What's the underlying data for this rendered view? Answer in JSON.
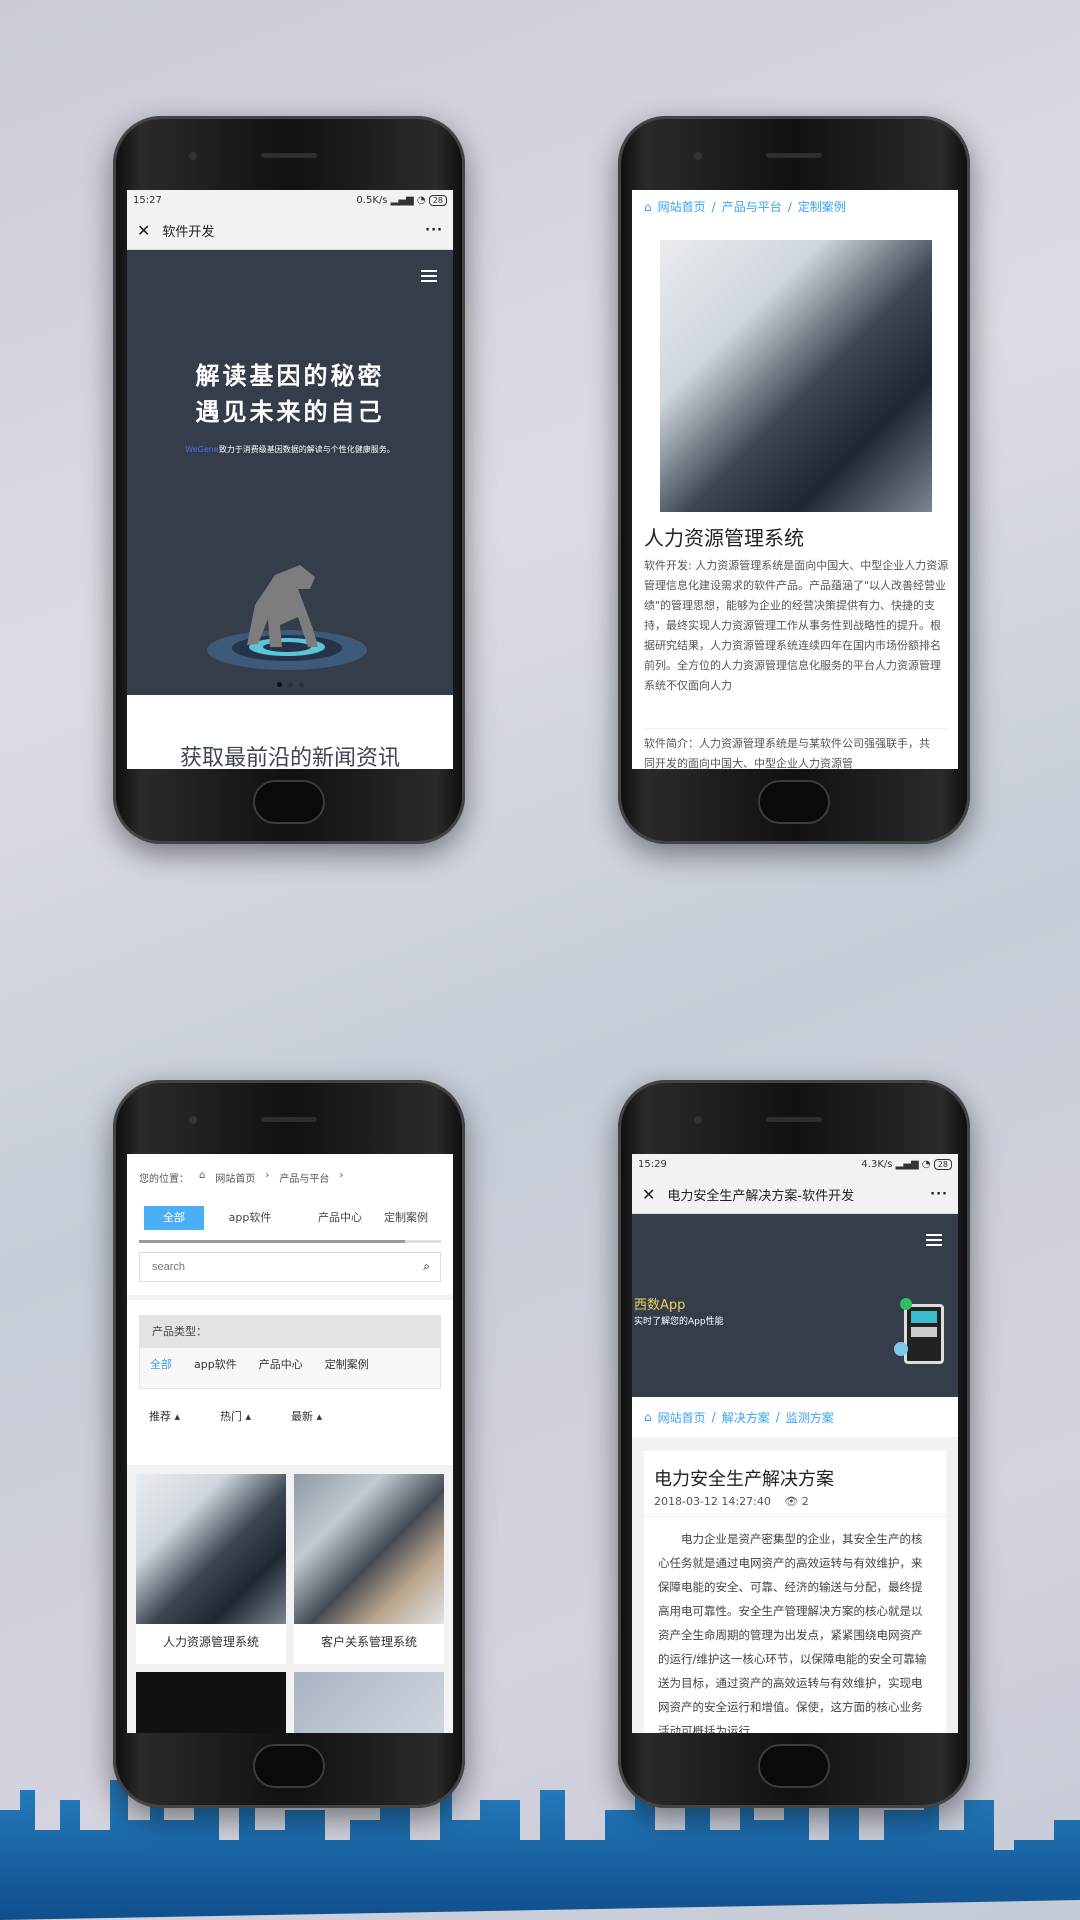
{
  "phone1": {
    "status": {
      "time": "15:27",
      "speed": "0.5K/s",
      "battery": "28"
    },
    "titlebar": {
      "title": "软件开发",
      "close_icon": "close-icon",
      "more": "···"
    },
    "hero": {
      "line1": "解读基因的秘密",
      "line2": "遇见未来的自己",
      "brand": "WeGene",
      "tagline": "致力于消费级基因数据的解读与个性化健康服务。"
    },
    "carousel": {
      "count": 3,
      "active": 1
    },
    "section_title": "获取最前沿的新闻资讯"
  },
  "phone2": {
    "breadcrumb": [
      "网站首页",
      "产品与平台",
      "定制案例"
    ],
    "title": "人力资源管理系统",
    "body": "软件开发: 人力资源管理系统是面向中国大、中型企业人力资源管理信息化建设需求的软件产品。产品蕴涵了\"以人改善经营业绩\"的管理思想，能够为企业的经营决策提供有力、快捷的支持，最终实现人力资源管理工作从事务性到战略性的提升。根据研究结果，人力资源管理系统连续四年在国内市场份额排名前列。全方位的人力资源管理信息化服务的平台人力资源管理系统不仅面向人力",
    "intro": "软件简介：人力资源管理系统是与某软件公司强强联手，共同开发的面向中国大、中型企业人力资源管"
  },
  "phone3": {
    "breadcrumb": {
      "label": "您的位置：",
      "items": [
        "网站首页",
        "产品与平台"
      ]
    },
    "tabs": [
      "全部",
      "app软件",
      "产品中心",
      "定制案例"
    ],
    "search_placeholder": "search",
    "filter": {
      "label": "产品类型：",
      "options": [
        "全部",
        "app软件",
        "产品中心",
        "定制案例"
      ]
    },
    "sort": [
      "推荐",
      "热门",
      "最新"
    ],
    "cards": [
      "人力资源管理系统",
      "客户关系管理系统"
    ]
  },
  "phone4": {
    "status": {
      "time": "15:29",
      "speed": "4.3K/s",
      "battery": "28"
    },
    "titlebar": {
      "title": "电力安全生产解决方案-软件开发",
      "more": "···"
    },
    "hero": {
      "title": "西数App",
      "subtitle": "实时了解您的App性能"
    },
    "breadcrumb": [
      "网站首页",
      "解决方案",
      "监测方案"
    ],
    "article": {
      "title": "电力安全生产解决方案",
      "date": "2018-03-12 14:27:40",
      "views": "2",
      "body": "电力企业是资产密集型的企业，其安全生产的核心任务就是通过电网资产的高效运转与有效维护，来保障电能的安全、可靠、经济的输送与分配，最终提高用电可靠性。安全生产管理解决方案的核心就是以资产全生命周期的管理为出发点，紧紧围绕电网资产的运行/维护这一核心环节，以保障电能的安全可靠输送为目标，通过资产的高效运转与有效维护，实现电网资产的安全运行和增值。保使，这方面的核心业务活动可概括为运行"
    }
  },
  "colors": {
    "accent": "#3aa2f0",
    "hero_bg": "#353d4b",
    "skyline": "#1f6fb5"
  }
}
